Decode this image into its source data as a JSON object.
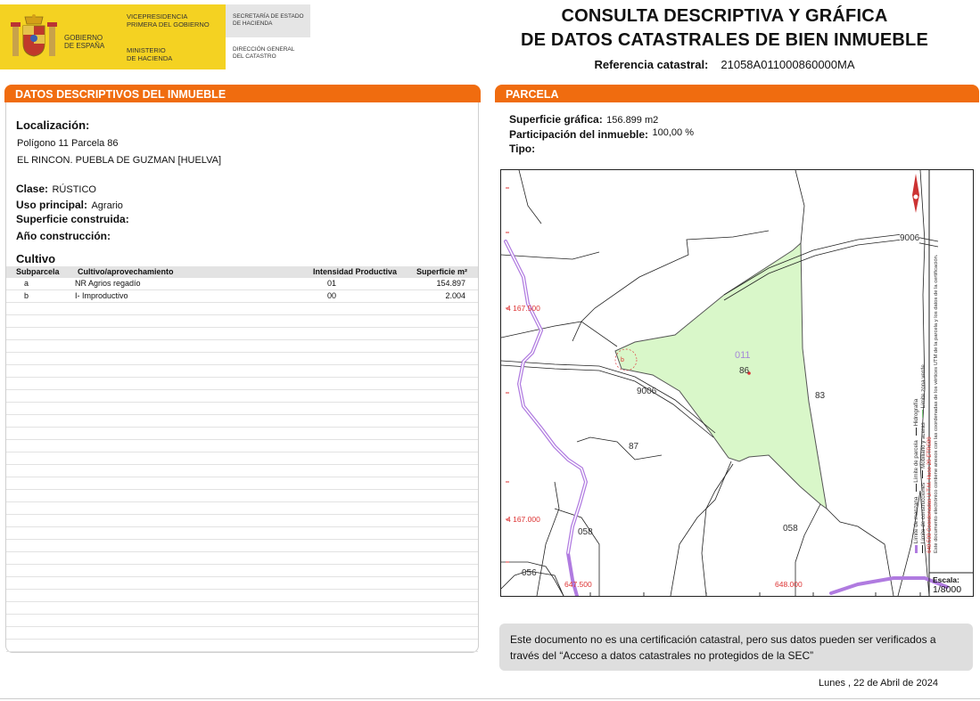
{
  "header": {
    "gov_line1": "GOBIERNO",
    "gov_line2": "DE ESPAÑA",
    "vice_line1": "VICEPRESIDENCIA",
    "vice_line2": "PRIMERA DEL GOBIERNO",
    "min_line1": "MINISTERIO",
    "min_line2": "DE HACIENDA",
    "sec_line1": "SECRETARÍA DE ESTADO",
    "sec_line2": "DE HACIENDA",
    "dir_line1": "DIRECCIÓN GENERAL",
    "dir_line2": "DEL CATASTRO",
    "title_line1": "CONSULTA DESCRIPTIVA Y GRÁFICA",
    "title_line2": "DE DATOS CATASTRALES DE BIEN INMUEBLE",
    "ref_label": "Referencia catastral:",
    "ref_value": "21058A011000860000MA"
  },
  "left": {
    "bar_title_a": "DATOS DESCRIPTIVOS DEL ",
    "bar_title_b": "INMUEBLE",
    "loc_label": "Localización:",
    "loc_line1": "Polígono 11 Parcela 86",
    "loc_line2": "EL RINCON. PUEBLA DE GUZMAN [HUELVA]",
    "clase_label": "Clase:",
    "clase_value": "RÚSTICO",
    "uso_label": "Uso principal:",
    "uso_value": "Agrario",
    "sup_label": "Superficie construida:",
    "anio_label": "Año construcción:",
    "cultivo_label": "Cultivo",
    "table": {
      "headers": [
        "Subparcela",
        "Cultivo/aprovechamiento",
        "Intensidad Productiva",
        "Superficie m²"
      ],
      "rows": [
        [
          "a",
          "NR Agrios regadío",
          "01",
          "154.897"
        ],
        [
          "b",
          "I- Improductivo",
          "00",
          "2.004"
        ]
      ]
    }
  },
  "right": {
    "bar_title": "PARCELA",
    "sup_label": "Superficie gráfica:",
    "sup_value": "156.899 m2",
    "part_label": "Participación del inmueble:",
    "part_value": "100,00 %",
    "tipo_label": "Tipo:"
  },
  "map": {
    "labels": {
      "parcel_code": "011",
      "parcel_num": "86",
      "sub_b": "b",
      "road1": "9006",
      "road2": "9006",
      "p83": "83",
      "p87": "87",
      "p058a": "058",
      "p058b": "058",
      "p056": "056",
      "y1": "4 167.500",
      "y2": "4 167.000",
      "x1": "647.500",
      "x2": "648.000"
    },
    "legend_line1": "Límite de manzana",
    "legend_line2": "Límite de parcela",
    "legend_line3": "Hidrografía",
    "legend_line4": "Límite de construcciones",
    "legend_line5": "Mobiliario y aceras",
    "legend_line6": "Límite zona verde",
    "legend_coords": "648.500 Coordenadas U.T.M. Huso 29 ETRS89",
    "legend_note": "Este documento electrónico contiene anexos con las coordenadas de los vértices UTM de la parcela y los datos de la certificación.",
    "scale_label": "Escala:",
    "scale_value": "1/8000"
  },
  "note": {
    "text": "Este documento no es una certificación catastral, pero sus datos pueden ser verificados a través del “Acceso a datos catastrales no protegidos de la SEC”"
  },
  "date": "Lunes , 22 de Abril de 2024",
  "colors": {
    "orange": "#f06c0f",
    "yellow": "#f4d222",
    "parcel_fill": "#d9f7c9",
    "stream": "#b07be0"
  }
}
